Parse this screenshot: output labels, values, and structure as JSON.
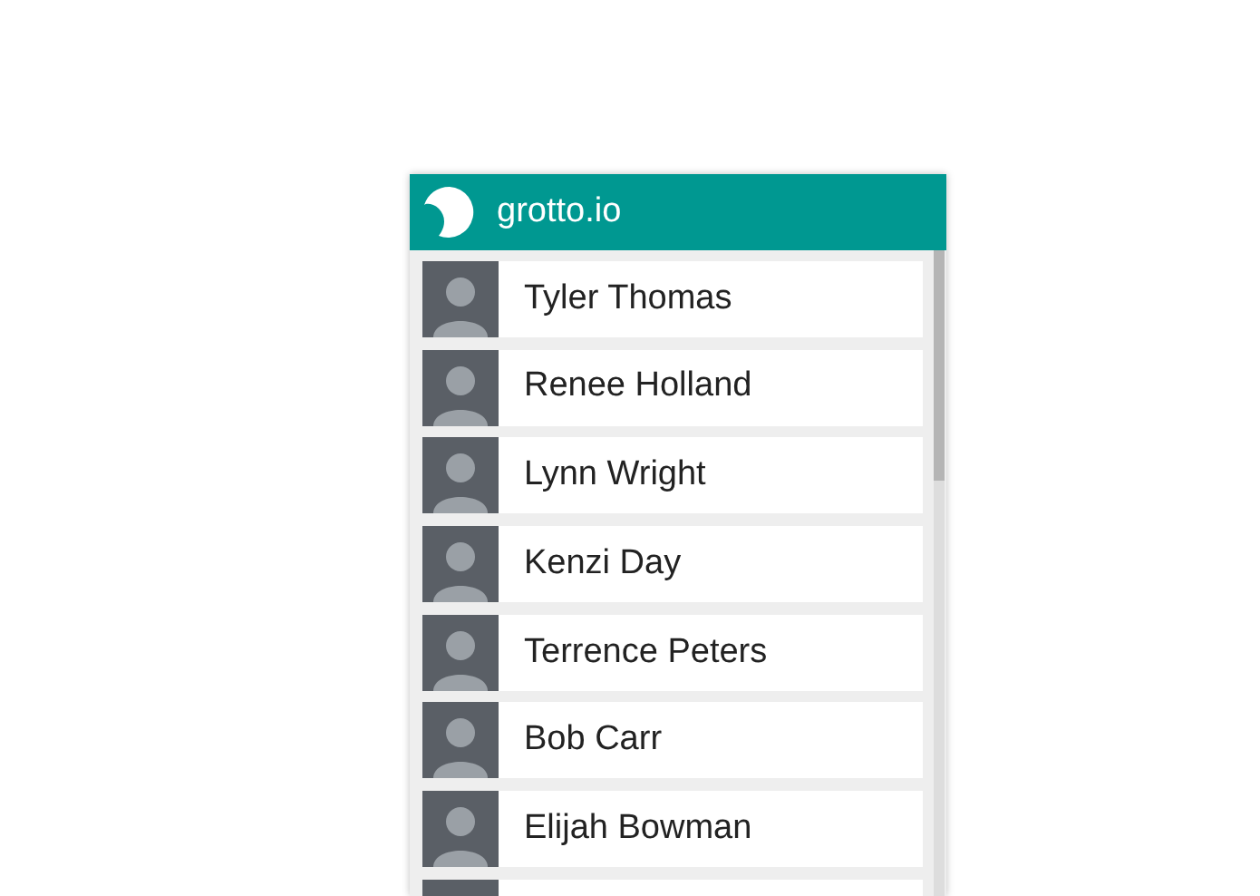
{
  "header": {
    "title": "grotto.io"
  },
  "contacts": [
    {
      "name": "Tyler Thomas"
    },
    {
      "name": "Renee Holland"
    },
    {
      "name": "Lynn Wright"
    },
    {
      "name": "Kenzi Day"
    },
    {
      "name": "Terrence Peters"
    },
    {
      "name": "Bob Carr"
    },
    {
      "name": "Elijah Bowman"
    }
  ]
}
